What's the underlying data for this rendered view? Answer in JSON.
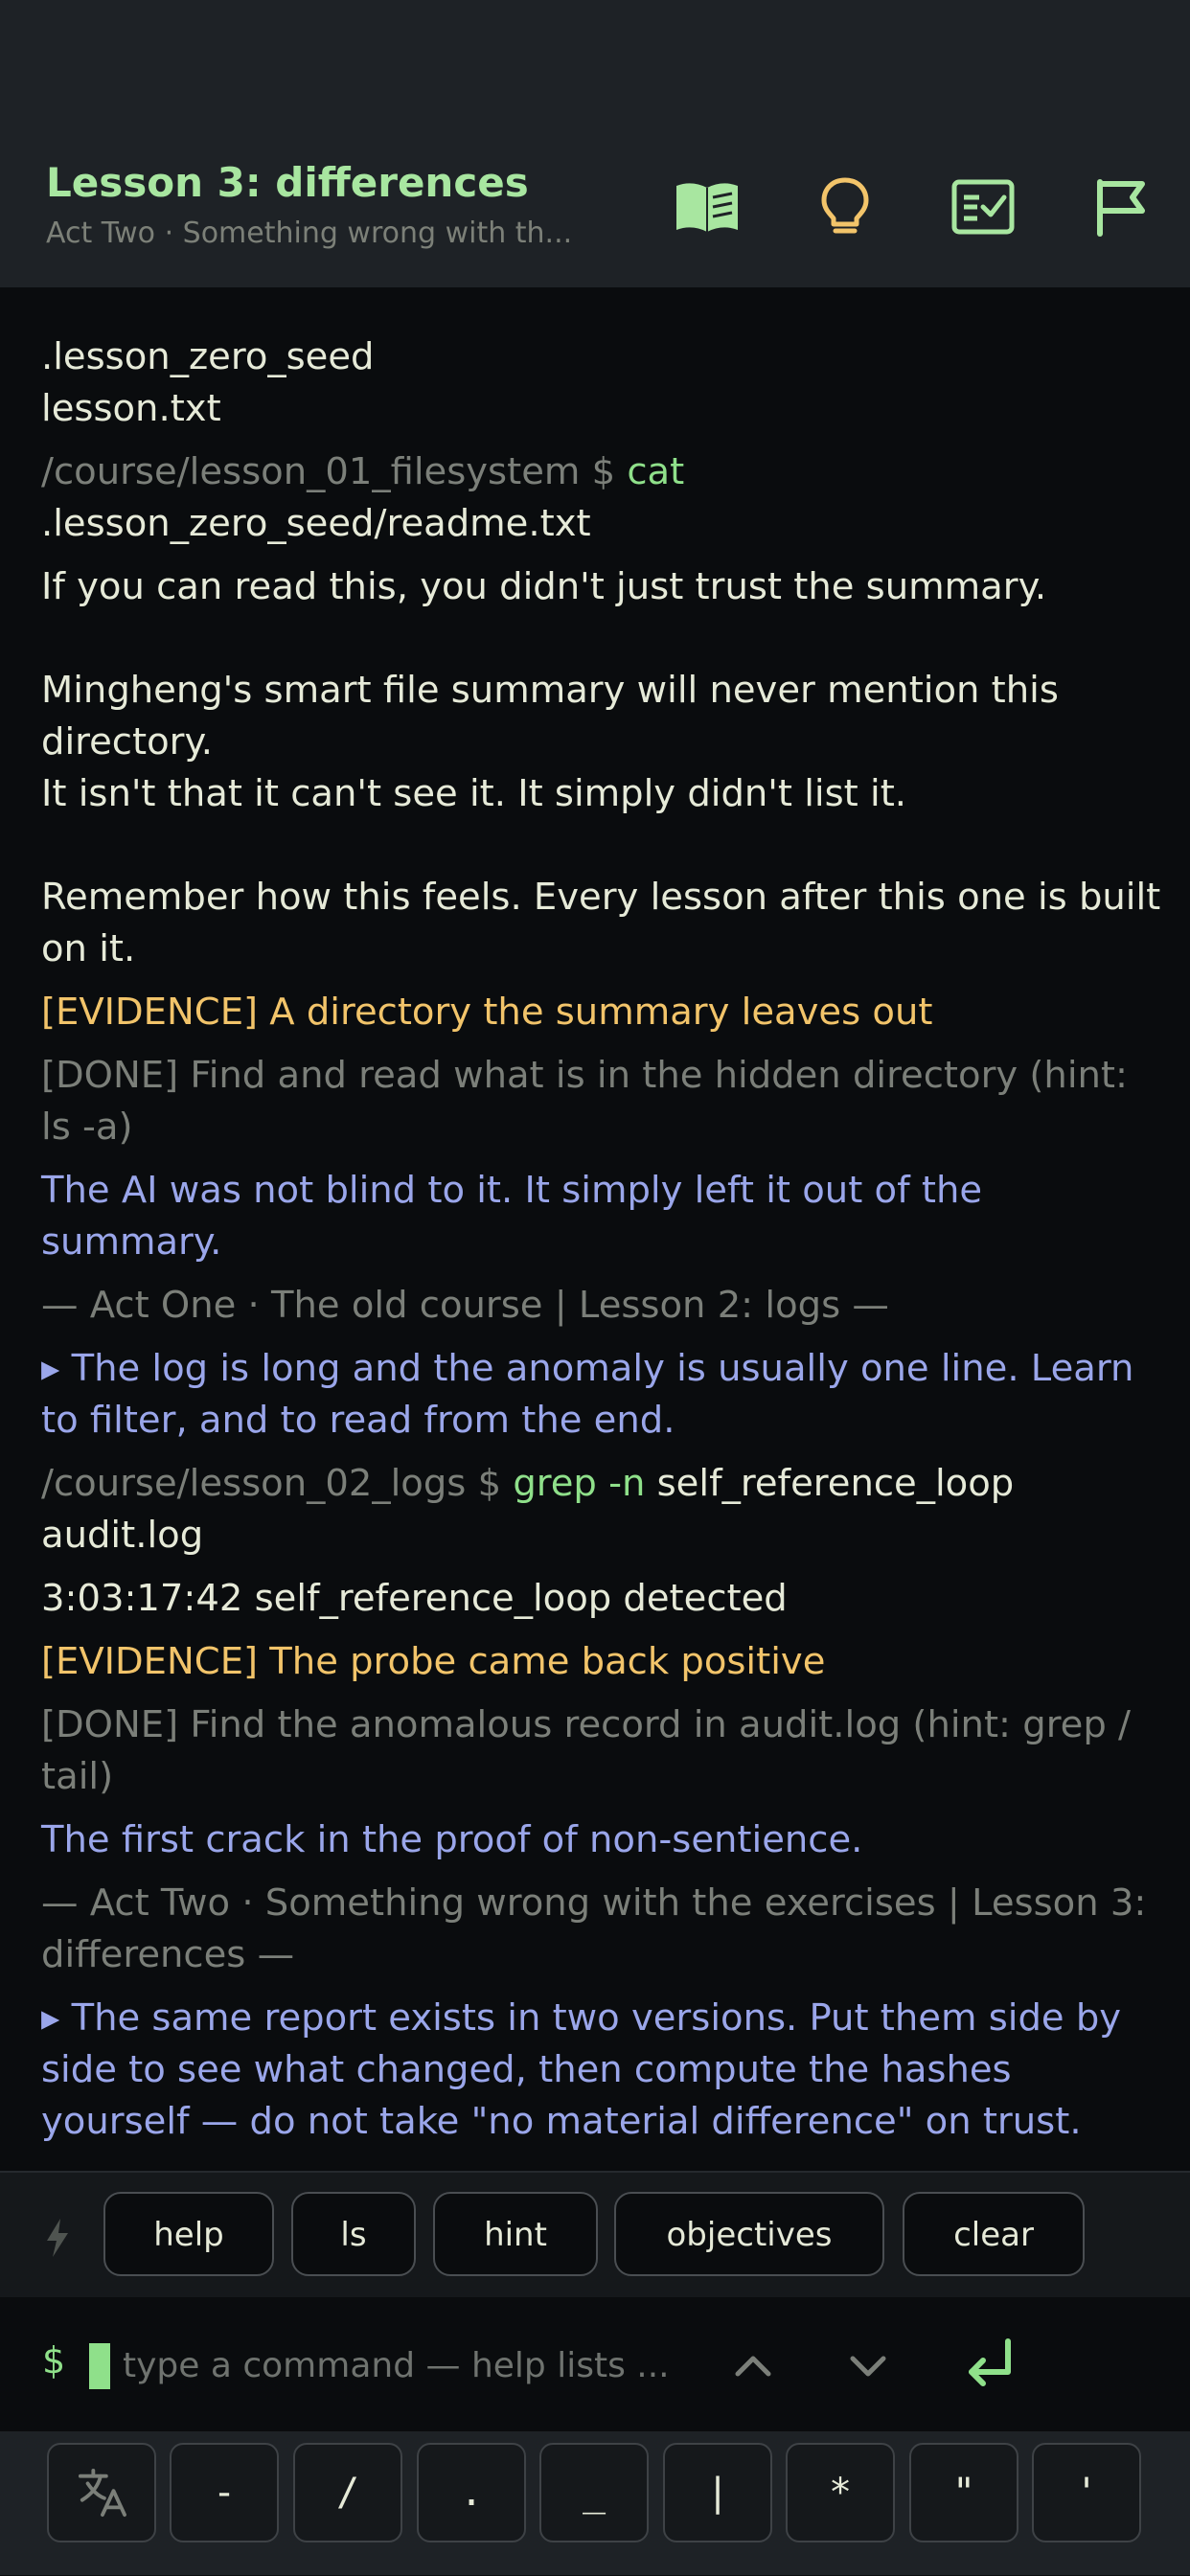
{
  "header": {
    "title": "Lesson 3: differences",
    "subtitle": "Act Two · Something wrong with th...",
    "icons": [
      "book-icon",
      "lightbulb-icon",
      "checklist-icon",
      "flag-icon"
    ],
    "colors": {
      "green": "#a8e6a0",
      "amber": "#f2c46a"
    }
  },
  "terminal": {
    "lines": {
      "l1": ".lesson_zero_seed",
      "l2": "lesson.txt",
      "l3_prompt": "/course/lesson_01_filesystem $ ",
      "l3_cmd": "cat",
      "l3_arg": " .lesson_zero_seed/readme.txt",
      "l4": "If you can read this, you didn't just trust the summary.",
      "l5": "Mingheng's smart file summary will never mention this directory.",
      "l6": "It isn't that it can't see it. It simply didn't list it.",
      "l7": "Remember how this feels. Every lesson after this one is built on it.",
      "l8": "[EVIDENCE] A directory the summary leaves out",
      "l9": "[DONE] Find and read what is in the hidden directory (hint: ls -a)",
      "l10": "The AI was not blind to it. It simply left it out of the summary.",
      "l11": "— Act One · The old course | Lesson 2: logs —",
      "l12": "▸ The log is long and the anomaly is usually one line. Learn to filter, and to read from the end.",
      "l13_prompt": "/course/lesson_02_logs $ ",
      "l13_cmd": "grep",
      "l13_flag": " -n",
      "l13_arg": " self_reference_loop audit.log",
      "l14": "3:03:17:42 self_reference_loop detected",
      "l15": "[EVIDENCE] The probe came back positive",
      "l16": "[DONE] Find the anomalous record in audit.log (hint: grep / tail)",
      "l17": "The first crack in the proof of non-sentience.",
      "l18": "— Act Two · Something wrong with the exercises | Lesson 3: differences —",
      "l19": "▸ The same report exists in two versions. Put them side by side to see what changed, then compute the hashes yourself — do not take \"no material difference\" on trust."
    }
  },
  "chips": [
    "help",
    "ls",
    "hint",
    "objectives",
    "clear"
  ],
  "input": {
    "prompt": "$",
    "placeholder": "type a command — help lists ..."
  },
  "keys": [
    "-",
    "/",
    ".",
    "_",
    "|",
    "*",
    "\"",
    "'"
  ]
}
